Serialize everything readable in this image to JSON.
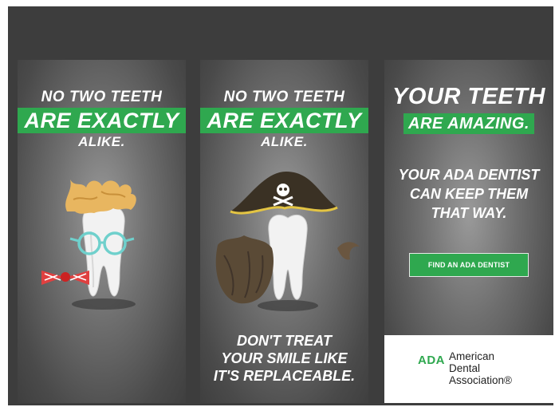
{
  "panel1": {
    "line1": "NO TWO TEETH",
    "highlight": "ARE EXACTLY",
    "line3": "ALIKE."
  },
  "panel2": {
    "line1": "NO TWO TEETH",
    "highlight": "ARE EXACTLY",
    "line3": "ALIKE.",
    "bottom_lines": [
      "DON'T TREAT",
      "YOUR SMILE LIKE",
      "IT'S REPLACEABLE."
    ]
  },
  "panel3": {
    "headline": "YOUR TEETH",
    "highlight": "ARE AMAZING.",
    "body_lines": [
      "YOUR ADA DENTIST",
      "CAN KEEP THEM",
      "THAT WAY."
    ],
    "cta_label": "FIND AN ADA DENTIST",
    "logo": {
      "mark": "ADA",
      "lines": [
        "American",
        "Dental",
        "Association®"
      ]
    }
  },
  "colors": {
    "accent_green": "#2fa84f",
    "background": "#3d3d3d"
  },
  "icons": [
    "tooth-with-wig-icon",
    "glasses-icon",
    "bow-tie-icon",
    "tooth-with-pirate-hat-icon",
    "skull-crossbones-icon",
    "beard-icon",
    "mustache-icon"
  ]
}
